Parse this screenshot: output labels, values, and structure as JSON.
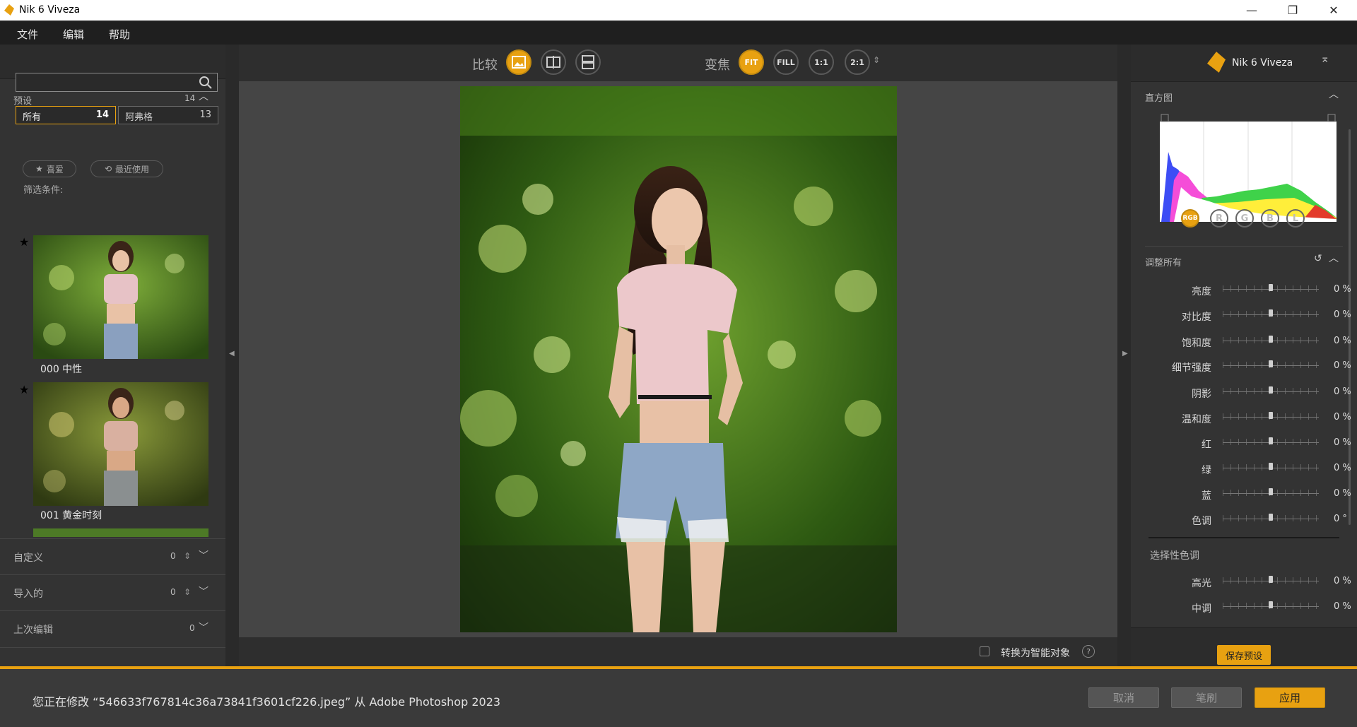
{
  "window": {
    "title": "Nik 6 Viveza",
    "min": "—",
    "restore": "❐",
    "close": "✕"
  },
  "menu": [
    "文件",
    "编辑",
    "帮助"
  ],
  "presets": {
    "label": "预设",
    "count": "14",
    "tabs": [
      {
        "label": "所有",
        "count": "14"
      },
      {
        "label": "阿弗格",
        "count": "13"
      }
    ],
    "filter_label": "筛选条件:",
    "chips": [
      "喜爱",
      "最近使用"
    ],
    "thumbnails": [
      "000 中性",
      "001 黄金时刻"
    ],
    "sections": [
      {
        "label": "自定义",
        "count": "0"
      },
      {
        "label": "导入的",
        "count": "0"
      },
      {
        "label": "上次编辑",
        "count": "0"
      }
    ]
  },
  "toolbar": {
    "compare_label": "比较",
    "zoom_label": "变焦",
    "zoom_options": [
      "FIT",
      "FILL",
      "1:1",
      "2:1"
    ],
    "active_zoom": "FIT"
  },
  "canvas": {
    "smart_object_label": "转换为智能对象",
    "help": "?"
  },
  "right": {
    "brand": "Nik 6 Viveza",
    "histogram_label": "直方图",
    "channels": [
      "RGB",
      "R",
      "G",
      "B",
      "L"
    ],
    "active_channel": "RGB",
    "adjust_all_label": "调整所有",
    "sliders": [
      {
        "label": "亮度",
        "value": "0 %"
      },
      {
        "label": "对比度",
        "value": "0 %"
      },
      {
        "label": "饱和度",
        "value": "0 %"
      },
      {
        "label": "细节强度",
        "value": "0 %"
      },
      {
        "label": "阴影",
        "value": "0 %"
      },
      {
        "label": "温和度",
        "value": "0 %"
      },
      {
        "label": "红",
        "value": "0 %"
      },
      {
        "label": "绿",
        "value": "0 %"
      },
      {
        "label": "蓝",
        "value": "0 %"
      },
      {
        "label": "色调",
        "value": "0 °"
      }
    ],
    "selective_label": "选择性色调",
    "selective_sliders": [
      {
        "label": "高光",
        "value": "0 %"
      },
      {
        "label": "中调",
        "value": "0 %"
      }
    ],
    "save_preset": "保存预设"
  },
  "status": {
    "message": "您正在修改 “546633f767814c36a73841f3601cf226.jpeg” 从 Adobe Photoshop 2023",
    "cancel": "取消",
    "brush": "笔刷",
    "apply": "应用"
  },
  "colors": {
    "accent": "#e8a111",
    "panel": "#333333",
    "canvas": "#454545"
  }
}
